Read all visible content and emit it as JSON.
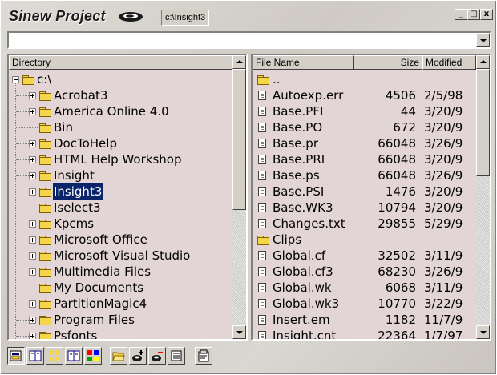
{
  "window": {
    "title": "Sinew Project",
    "current_path": "c:\\Insight3",
    "buttons": {
      "minimize": "_",
      "restore": "□",
      "close": "x"
    }
  },
  "address": {
    "value": "",
    "placeholder": ""
  },
  "tree": {
    "header": "Directory",
    "root": "c:\\",
    "items": [
      {
        "label": "Acrobat3",
        "expandable": true
      },
      {
        "label": "America Online 4.0",
        "expandable": true
      },
      {
        "label": "Bin",
        "expandable": false
      },
      {
        "label": "DocToHelp",
        "expandable": true
      },
      {
        "label": "HTML Help Workshop",
        "expandable": true
      },
      {
        "label": "Insight",
        "expandable": true
      },
      {
        "label": "Insight3",
        "expandable": true,
        "selected": true
      },
      {
        "label": "Iselect3",
        "expandable": false
      },
      {
        "label": "Kpcms",
        "expandable": true
      },
      {
        "label": "Microsoft Office",
        "expandable": true
      },
      {
        "label": "Microsoft Visual Studio",
        "expandable": true
      },
      {
        "label": "Multimedia Files",
        "expandable": true
      },
      {
        "label": "My Documents",
        "expandable": false
      },
      {
        "label": "PartitionMagic4",
        "expandable": true
      },
      {
        "label": "Program Files",
        "expandable": true
      },
      {
        "label": "Psfonts",
        "expandable": true
      }
    ]
  },
  "files": {
    "columns": {
      "name": "File Name",
      "size": "Size",
      "modified": "Modified"
    },
    "rows": [
      {
        "type": "parent",
        "name": "..",
        "size": "",
        "modified": ""
      },
      {
        "type": "file",
        "name": "Autoexp.err",
        "size": "4506",
        "modified": "2/5/98"
      },
      {
        "type": "file",
        "name": "Base.PFI",
        "size": "44",
        "modified": "3/20/9"
      },
      {
        "type": "file",
        "name": "Base.PO",
        "size": "672",
        "modified": "3/20/9"
      },
      {
        "type": "file",
        "name": "Base.pr",
        "size": "66048",
        "modified": "3/26/9"
      },
      {
        "type": "file",
        "name": "Base.PRI",
        "size": "66048",
        "modified": "3/20/9"
      },
      {
        "type": "file",
        "name": "Base.ps",
        "size": "66048",
        "modified": "3/26/9"
      },
      {
        "type": "file",
        "name": "Base.PSI",
        "size": "1476",
        "modified": "3/20/9"
      },
      {
        "type": "file",
        "name": "Base.WK3",
        "size": "10794",
        "modified": "3/20/9"
      },
      {
        "type": "file",
        "name": "Changes.txt",
        "size": "29855",
        "modified": "5/29/9"
      },
      {
        "type": "folder",
        "name": "Clips",
        "size": "",
        "modified": ""
      },
      {
        "type": "file",
        "name": "Global.cf",
        "size": "32502",
        "modified": "3/11/9"
      },
      {
        "type": "file",
        "name": "Global.cf3",
        "size": "68230",
        "modified": "3/26/9"
      },
      {
        "type": "file",
        "name": "Global.wk",
        "size": "6068",
        "modified": "3/11/9"
      },
      {
        "type": "file",
        "name": "Global.wk3",
        "size": "10770",
        "modified": "3/22/9"
      },
      {
        "type": "file",
        "name": "Insert.em",
        "size": "1182",
        "modified": "11/7/9"
      },
      {
        "type": "file",
        "name": "Insight.cnt",
        "size": "22364",
        "modified": "1/7/97"
      }
    ]
  },
  "toolbar": {
    "buttons": [
      "open-project-icon",
      "two-pane-view-icon",
      "grid-view-icon",
      "book-icon",
      "color-palette-icon",
      "open-folder-icon",
      "add-disk-icon",
      "remove-disk-icon",
      "document-icon",
      "properties-icon"
    ]
  },
  "colors": {
    "pane_bg": "#e3d5d5",
    "selection": "#0a246a",
    "folder": "#f5d64a"
  }
}
